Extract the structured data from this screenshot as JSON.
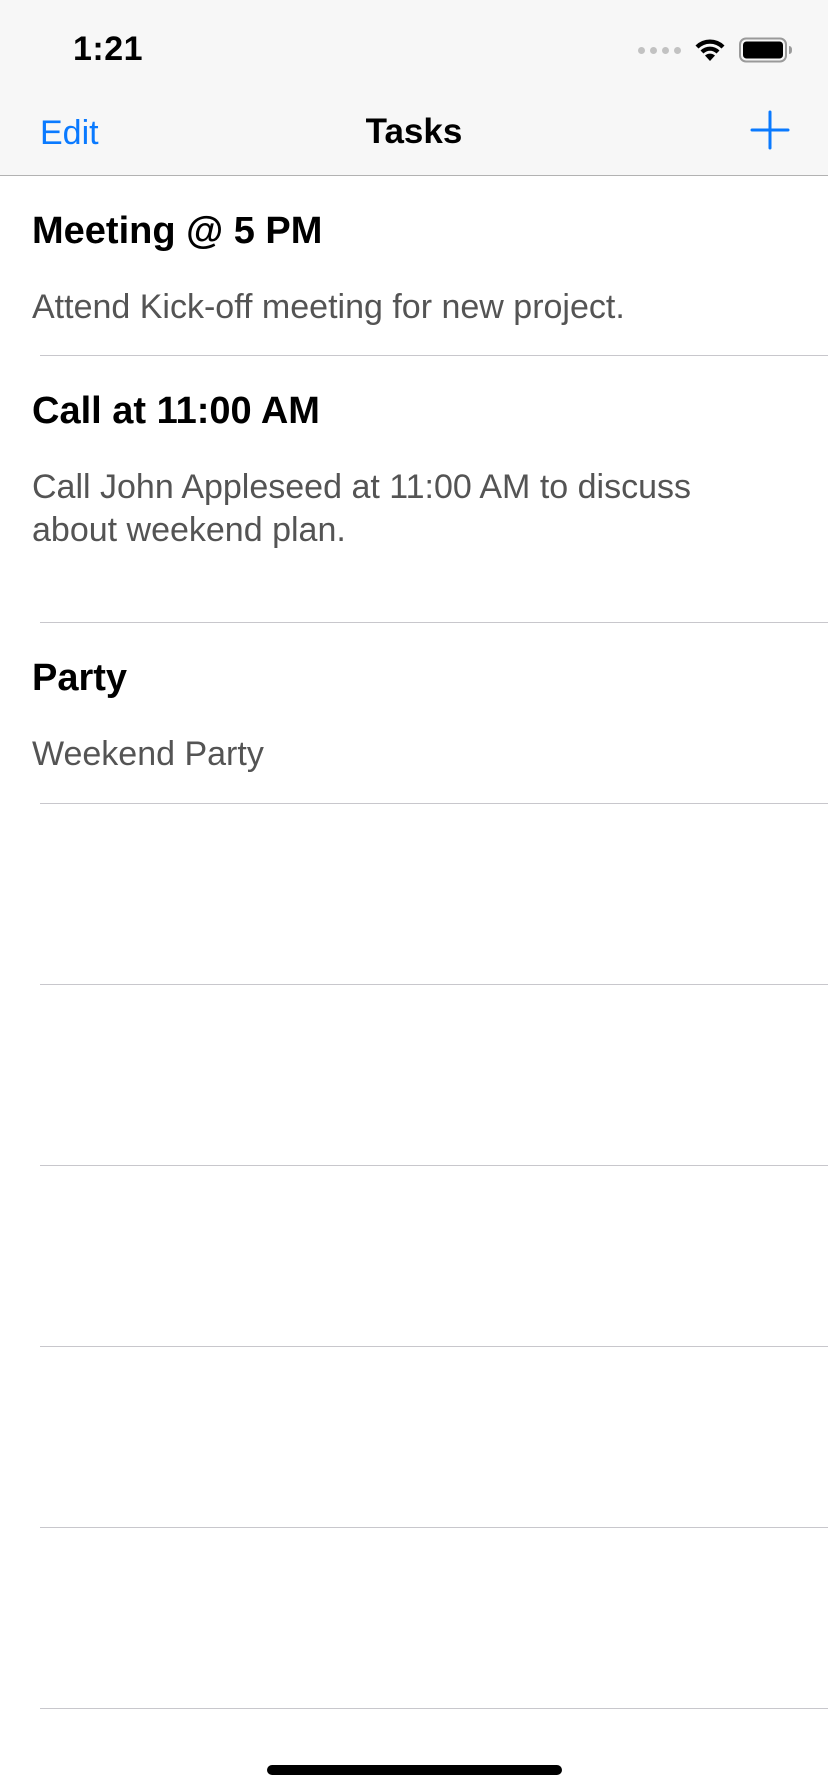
{
  "status_bar": {
    "time": "1:21",
    "icons": [
      "cellular-signal-icon",
      "wifi-icon",
      "battery-icon"
    ]
  },
  "nav": {
    "edit_label": "Edit",
    "title": "Tasks",
    "add_icon": "plus-icon"
  },
  "tasks": [
    {
      "title": "Meeting @ 5 PM",
      "description": "Attend Kick-off meeting for new project."
    },
    {
      "title": "Call at 11:00 AM",
      "description": "Call John Appleseed at 11:00 AM to discuss about weekend plan."
    },
    {
      "title": "Party",
      "description": "Weekend Party"
    }
  ],
  "colors": {
    "accent": "#0a7aff",
    "title_text": "#000000",
    "secondary_text": "#545454",
    "separator": "#c8c7cc",
    "bar_background": "#f7f7f7"
  }
}
